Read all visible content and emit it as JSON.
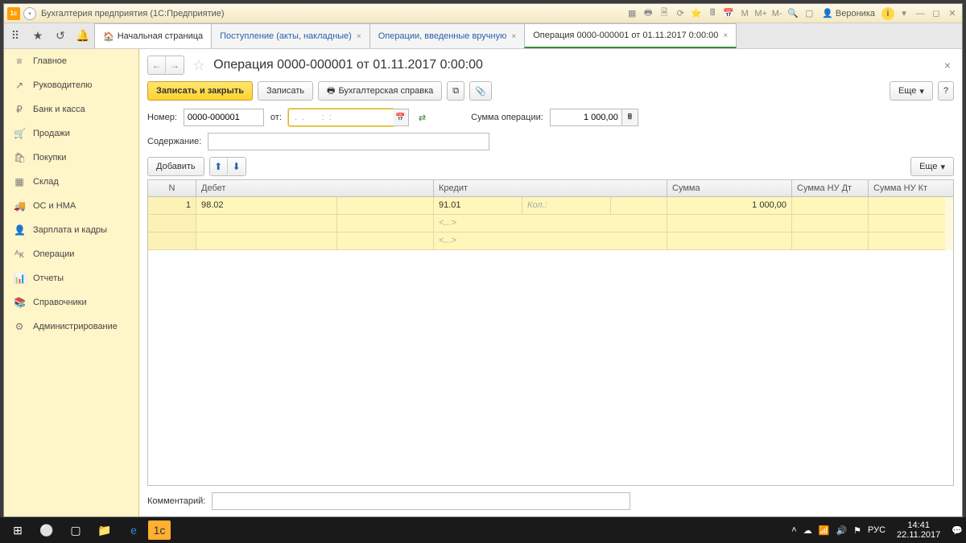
{
  "titlebar": {
    "app_title": "Бухгалтерия предприятия  (1С:Предприятие)",
    "user": "Вероника",
    "logo": "1с"
  },
  "tabs": {
    "home": "Начальная страница",
    "t1": "Поступление (акты, накладные)",
    "t2": "Операции, введенные вручную",
    "t3": "Операция 0000-000001 от 01.11.2017 0:00:00"
  },
  "sidebar": {
    "items": [
      {
        "icon": "≡",
        "label": "Главное"
      },
      {
        "icon": "↗",
        "label": "Руководителю"
      },
      {
        "icon": "₽",
        "label": "Банк и касса"
      },
      {
        "icon": "🛒",
        "label": "Продажи"
      },
      {
        "icon": "🛍",
        "label": "Покупки"
      },
      {
        "icon": "▦",
        "label": "Склад"
      },
      {
        "icon": "🚚",
        "label": "ОС и НМА"
      },
      {
        "icon": "👤",
        "label": "Зарплата и кадры"
      },
      {
        "icon": "ᴬᴋ",
        "label": "Операции"
      },
      {
        "icon": "📊",
        "label": "Отчеты"
      },
      {
        "icon": "📚",
        "label": "Справочники"
      },
      {
        "icon": "⚙",
        "label": "Администрирование"
      }
    ]
  },
  "page": {
    "title": "Операция 0000-000001 от 01.11.2017 0:00:00",
    "save_close": "Записать и закрыть",
    "save": "Записать",
    "print_ref": "Бухгалтерская справка",
    "more": "Еще",
    "number_lbl": "Номер:",
    "number_val": "0000-000001",
    "from_lbl": "от:",
    "date_val": " .  .       :  :",
    "sum_lbl": "Сумма операции:",
    "sum_val": "1 000,00",
    "content_lbl": "Содержание:",
    "content_val": "",
    "add": "Добавить",
    "comment_lbl": "Комментарий:",
    "comment_val": ""
  },
  "grid": {
    "head": {
      "n": "N",
      "debit": "Дебет",
      "credit": "Кредит",
      "sum": "Сумма",
      "sumnd": "Сумма НУ Дт",
      "sumnk": "Сумма НУ Кт"
    },
    "rows": [
      {
        "n": "1",
        "debit": "98.02",
        "credit": "91.01",
        "qty_lbl": "Кол.:",
        "sum": "1 000,00",
        "sub": "<...>"
      }
    ]
  },
  "taskbar": {
    "lang": "РУС",
    "time": "14:41",
    "date": "22.11.2017"
  }
}
